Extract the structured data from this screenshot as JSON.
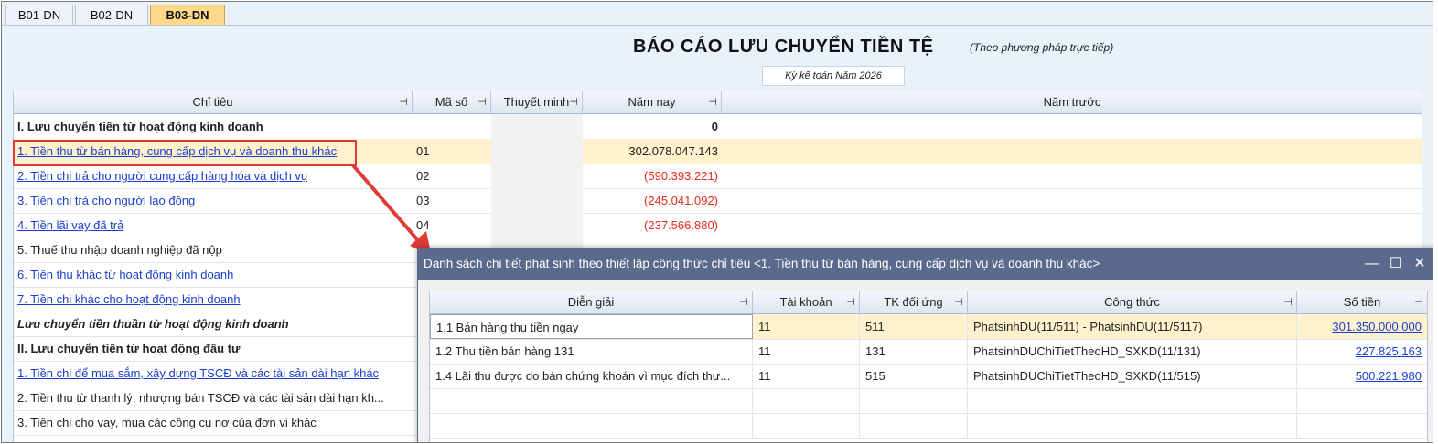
{
  "tabs": [
    {
      "label": "B01-DN",
      "active": false
    },
    {
      "label": "B02-DN",
      "active": false
    },
    {
      "label": "B03-DN",
      "active": true
    }
  ],
  "report": {
    "title": "BÁO CÁO LƯU CHUYỂN TIỀN TỆ",
    "subtitle": "(Theo phương pháp trực tiếp)",
    "period": "Kỳ kế toán Năm 2026"
  },
  "grid": {
    "columns": {
      "name": "Chỉ tiêu",
      "code": "Mã số",
      "note": "Thuyết minh",
      "current": "Năm nay",
      "previous": "Năm trước"
    },
    "pin_glyph": "⊣",
    "rows": [
      {
        "name": "I. Lưu chuyển tiền từ hoạt động kinh doanh",
        "code": "",
        "current": "0",
        "style": "bold"
      },
      {
        "name": "1. Tiền thu từ bán hàng, cung cấp dịch vụ và doanh thu khác",
        "code": "01",
        "current": "302.078.047.143",
        "style": "link"
      },
      {
        "name": "2. Tiền chi trả cho người cung cấp hàng hóa và dịch vụ",
        "code": "02",
        "current": "(590.393.221)",
        "style": "link"
      },
      {
        "name": "3. Tiền chi trả cho người lao động",
        "code": "03",
        "current": "(245.041.092)",
        "style": "link"
      },
      {
        "name": "4. Tiền lãi vay đã trả",
        "code": "04",
        "current": "(237.566.880)",
        "style": "link"
      },
      {
        "name": "5. Thuế thu nhập doanh nghiệp đã nộp",
        "code": "",
        "current": "",
        "style": "plain"
      },
      {
        "name": "6. Tiền thu khác từ hoạt động kinh doanh",
        "code": "",
        "current": "",
        "style": "link"
      },
      {
        "name": "7. Tiền chi khác cho hoạt động kinh doanh",
        "code": "",
        "current": "",
        "style": "link"
      },
      {
        "name": "Lưu chuyển tiền thuần từ hoạt động kinh doanh",
        "code": "",
        "current": "",
        "style": "bi"
      },
      {
        "name": "II. Lưu chuyển tiền từ hoạt động đầu tư",
        "code": "",
        "current": "",
        "style": "bold"
      },
      {
        "name": "1. Tiền chi để mua sắm, xây dựng TSCĐ và các tài sản dài hạn khác",
        "code": "",
        "current": "",
        "style": "link"
      },
      {
        "name": "2. Tiền thu từ thanh lý, nhượng bán TSCĐ và các tài sản dài hạn kh...",
        "code": "",
        "current": "",
        "style": "plain"
      },
      {
        "name": "3. Tiền chi cho vay, mua các công cụ nợ của đơn vị khác",
        "code": "",
        "current": "",
        "style": "plain"
      }
    ]
  },
  "popup": {
    "title": "Danh sách chi tiết phát sinh theo thiết lập công thức chỉ tiêu <1. Tiền thu từ bán hàng, cung cấp dịch vụ và doanh thu khác>",
    "minimize_glyph": "—",
    "maximize_glyph": "☐",
    "close_glyph": "✕",
    "columns": {
      "desc": "Diễn giải",
      "account": "Tài khoản",
      "opposite": "TK đối ứng",
      "formula": "Công thức",
      "amount": "Số tiền"
    },
    "rows": [
      {
        "desc": "1.1 Bán hàng thu tiền ngay",
        "account": "11",
        "opposite": "511",
        "formula": "PhatsinhDU(11/511) - PhatsinhDU(11/5117)",
        "amount": "301.350.000.000"
      },
      {
        "desc": "1.2 Thu tiền bán hàng 131",
        "account": "11",
        "opposite": "131",
        "formula": "PhatsinhDUChiTietTheoHD_SXKD(11/131)",
        "amount": "227.825.163"
      },
      {
        "desc": "1.4 Lãi thu được do bán chứng khoán vì mục đích thư...",
        "account": "11",
        "opposite": "515",
        "formula": "PhatsinhDUChiTietTheoHD_SXKD(11/515)",
        "amount": "500.221.980"
      }
    ]
  },
  "colors": {
    "accent_tab": "#ffd98a",
    "link": "#1a3fcf",
    "negative": "#e8291c",
    "selected_row": "#fff2cc",
    "popup_title": "#5a6a8c",
    "callout": "#e03b35"
  }
}
